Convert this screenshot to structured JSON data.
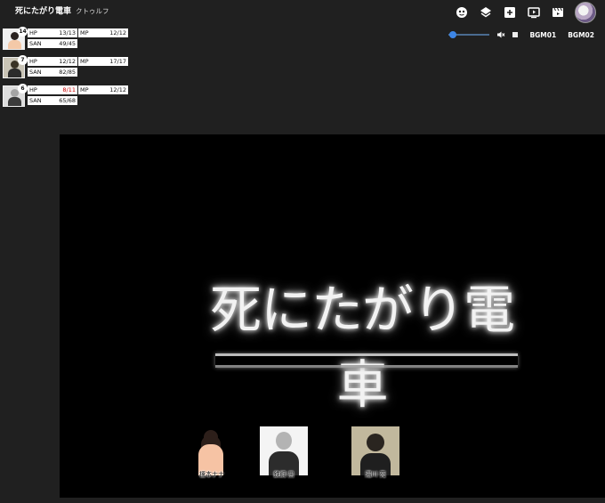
{
  "header": {
    "title": "死にたがり電車",
    "system": "クトゥルフ"
  },
  "toolbar": {
    "icons": [
      "dice-icon",
      "layers-icon",
      "add-icon",
      "play-screen-icon",
      "movie-icon"
    ],
    "avatar": "user-avatar"
  },
  "audio": {
    "volume": 0.05,
    "muted": true,
    "tracks": [
      "BGM01",
      "BGM02"
    ]
  },
  "characters": [
    {
      "initiative": "14",
      "hp": {
        "label": "HP",
        "value": "13/13"
      },
      "mp": {
        "label": "MP",
        "value": "12/12"
      },
      "san": {
        "label": "SAN",
        "value": "49/45"
      },
      "hp_low": false
    },
    {
      "initiative": "7",
      "hp": {
        "label": "HP",
        "value": "12/12"
      },
      "mp": {
        "label": "MP",
        "value": "17/17"
      },
      "san": {
        "label": "SAN",
        "value": "82/85"
      },
      "hp_low": false
    },
    {
      "initiative": "6",
      "hp": {
        "label": "HP",
        "value": "8/11"
      },
      "mp": {
        "label": "MP",
        "value": "12/12"
      },
      "san": {
        "label": "SAN",
        "value": "65/68"
      },
      "hp_low": true
    }
  ],
  "stage": {
    "logo_title": "死にたがり電車",
    "party": [
      {
        "name": "榎本ナナ"
      },
      {
        "name": "鉄鋼 黒"
      },
      {
        "name": "湯川 亮"
      }
    ]
  },
  "colors": {
    "background": "#202020",
    "stage": "#000000",
    "accent": "#3d86e6",
    "low_hp": "#cc0000"
  }
}
